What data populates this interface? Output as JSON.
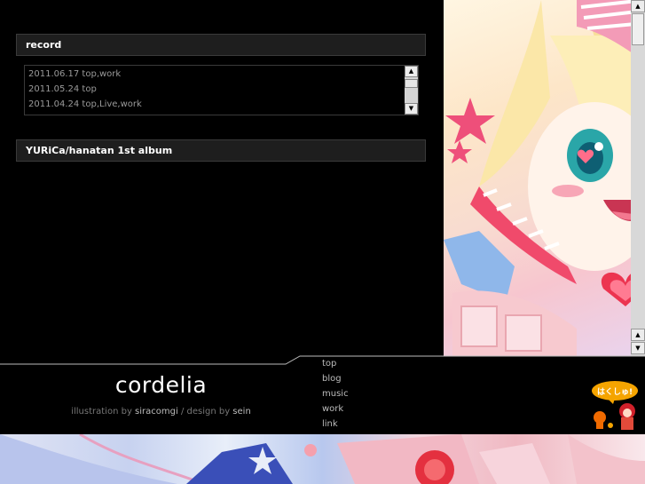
{
  "record": {
    "heading": "record",
    "items": [
      {
        "text": "2011.06.17 top,work"
      },
      {
        "text": "2011.05.24 top"
      },
      {
        "text": "2011.04.24 top,Live,work"
      }
    ]
  },
  "album": {
    "heading": "YURiCa/hanatan 1st album"
  },
  "site": {
    "title": "cordelia",
    "illustration_prefix": "illustration by ",
    "illustrator": "siracomgi",
    "separator": " / ",
    "design_prefix": "design by ",
    "designer": "sein"
  },
  "nav": {
    "items": [
      "top",
      "blog",
      "music",
      "work",
      "link"
    ]
  },
  "banner": {
    "label": "はくしゅ!"
  },
  "colors": {
    "background": "#000000",
    "panel": "#1e1e1e",
    "panel_border": "#3a3a3a",
    "muted_text": "#9a9a9a",
    "banner_orange": "#f5a400",
    "banner_red": "#d0202a"
  },
  "icons": {
    "scroll_up": "triangle-up-icon",
    "scroll_down": "triangle-down-icon"
  }
}
